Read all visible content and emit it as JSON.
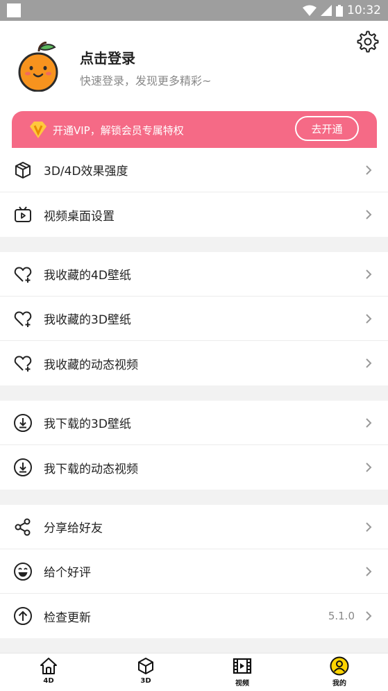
{
  "status_bar": {
    "time": "10:32"
  },
  "header": {
    "title": "点击登录",
    "subtitle": "快速登录，发现更多精彩~"
  },
  "vip": {
    "text": "开通VIP，解锁会员专属特权",
    "button": "去开通",
    "accent": "#f56a86"
  },
  "groups": [
    [
      {
        "icon": "cube-outline-icon",
        "label": "3D/4D效果强度"
      },
      {
        "icon": "tv-play-icon",
        "label": "视频桌面设置"
      }
    ],
    [
      {
        "icon": "heart-plus-icon",
        "label": "我收藏的4D壁纸"
      },
      {
        "icon": "heart-plus-icon",
        "label": "我收藏的3D壁纸"
      },
      {
        "icon": "heart-plus-icon",
        "label": "我收藏的动态视频"
      }
    ],
    [
      {
        "icon": "download-circle-icon",
        "label": "我下载的3D壁纸"
      },
      {
        "icon": "download-circle-icon",
        "label": "我下载的动态视频"
      }
    ],
    [
      {
        "icon": "share-icon",
        "label": "分享给好友"
      },
      {
        "icon": "smile-icon",
        "label": "给个好评"
      },
      {
        "icon": "update-circle-icon",
        "label": "检查更新",
        "value": "5.1.0"
      }
    ]
  ],
  "bottom_nav": [
    {
      "icon": "home-icon",
      "label": "4D"
    },
    {
      "icon": "cube-icon",
      "label": "3D"
    },
    {
      "icon": "film-icon",
      "label": "视频"
    },
    {
      "icon": "user-circle-icon",
      "label": "我的",
      "active": true
    }
  ]
}
